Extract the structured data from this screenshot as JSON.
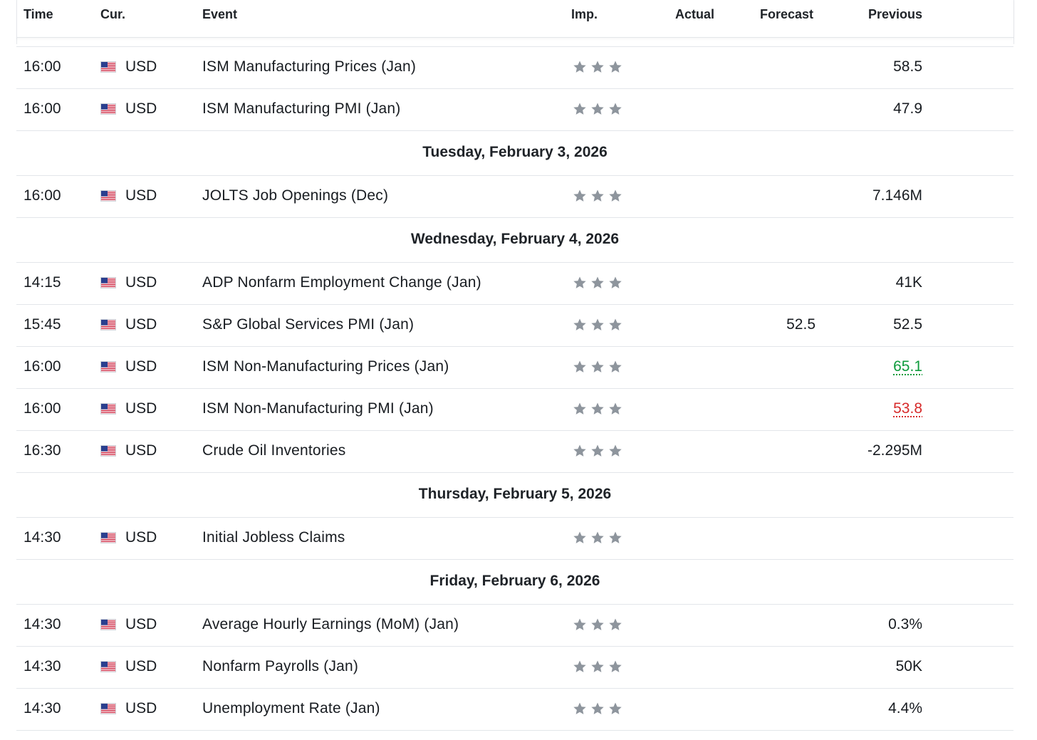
{
  "columns": {
    "time": "Time",
    "currency": "Cur.",
    "event": "Event",
    "importance": "Imp.",
    "actual": "Actual",
    "forecast": "Forecast",
    "previous": "Previous"
  },
  "colors": {
    "star": "#8e959d",
    "up": "#0e9b3c",
    "down": "#d72b2b",
    "divider": "#e3e6ea"
  },
  "sections": [
    {
      "date": "",
      "events": [
        {
          "time": "16:00",
          "flag": "us-flag-icon",
          "currency": "USD",
          "event": "ISM Manufacturing Prices  (Jan)",
          "stars": 3,
          "actual": "",
          "forecast": "",
          "previous": "58.5",
          "previous_trend": ""
        },
        {
          "time": "16:00",
          "flag": "us-flag-icon",
          "currency": "USD",
          "event": "ISM Manufacturing PMI  (Jan)",
          "stars": 3,
          "actual": "",
          "forecast": "",
          "previous": "47.9",
          "previous_trend": ""
        }
      ]
    },
    {
      "date": "Tuesday, February 3, 2026",
      "events": [
        {
          "time": "16:00",
          "flag": "us-flag-icon",
          "currency": "USD",
          "event": "JOLTS Job Openings  (Dec)",
          "stars": 3,
          "actual": "",
          "forecast": "",
          "previous": "7.146M",
          "previous_trend": ""
        }
      ]
    },
    {
      "date": "Wednesday, February 4, 2026",
      "events": [
        {
          "time": "14:15",
          "flag": "us-flag-icon",
          "currency": "USD",
          "event": "ADP Nonfarm Employment Change  (Jan)",
          "stars": 3,
          "actual": "",
          "forecast": "",
          "previous": "41K",
          "previous_trend": ""
        },
        {
          "time": "15:45",
          "flag": "us-flag-icon",
          "currency": "USD",
          "event": "S&P Global Services PMI  (Jan)",
          "stars": 3,
          "actual": "",
          "forecast": "52.5",
          "previous": "52.5",
          "previous_trend": ""
        },
        {
          "time": "16:00",
          "flag": "us-flag-icon",
          "currency": "USD",
          "event": "ISM Non-Manufacturing Prices  (Jan)",
          "stars": 3,
          "actual": "",
          "forecast": "",
          "previous": "65.1",
          "previous_trend": "up"
        },
        {
          "time": "16:00",
          "flag": "us-flag-icon",
          "currency": "USD",
          "event": "ISM Non-Manufacturing PMI  (Jan)",
          "stars": 3,
          "actual": "",
          "forecast": "",
          "previous": "53.8",
          "previous_trend": "down"
        },
        {
          "time": "16:30",
          "flag": "us-flag-icon",
          "currency": "USD",
          "event": "Crude Oil Inventories",
          "stars": 3,
          "actual": "",
          "forecast": "",
          "previous": "-2.295M",
          "previous_trend": ""
        }
      ]
    },
    {
      "date": "Thursday, February 5, 2026",
      "events": [
        {
          "time": "14:30",
          "flag": "us-flag-icon",
          "currency": "USD",
          "event": "Initial Jobless Claims",
          "stars": 3,
          "actual": "",
          "forecast": "",
          "previous": "",
          "previous_trend": ""
        }
      ]
    },
    {
      "date": "Friday, February 6, 2026",
      "events": [
        {
          "time": "14:30",
          "flag": "us-flag-icon",
          "currency": "USD",
          "event": "Average Hourly Earnings (MoM) (Jan)",
          "stars": 3,
          "actual": "",
          "forecast": "",
          "previous": "0.3%",
          "previous_trend": ""
        },
        {
          "time": "14:30",
          "flag": "us-flag-icon",
          "currency": "USD",
          "event": "Nonfarm Payrolls  (Jan)",
          "stars": 3,
          "actual": "",
          "forecast": "",
          "previous": "50K",
          "previous_trend": ""
        },
        {
          "time": "14:30",
          "flag": "us-flag-icon",
          "currency": "USD",
          "event": "Unemployment Rate  (Jan)",
          "stars": 3,
          "actual": "",
          "forecast": "",
          "previous": "4.4%",
          "previous_trend": ""
        }
      ]
    }
  ]
}
